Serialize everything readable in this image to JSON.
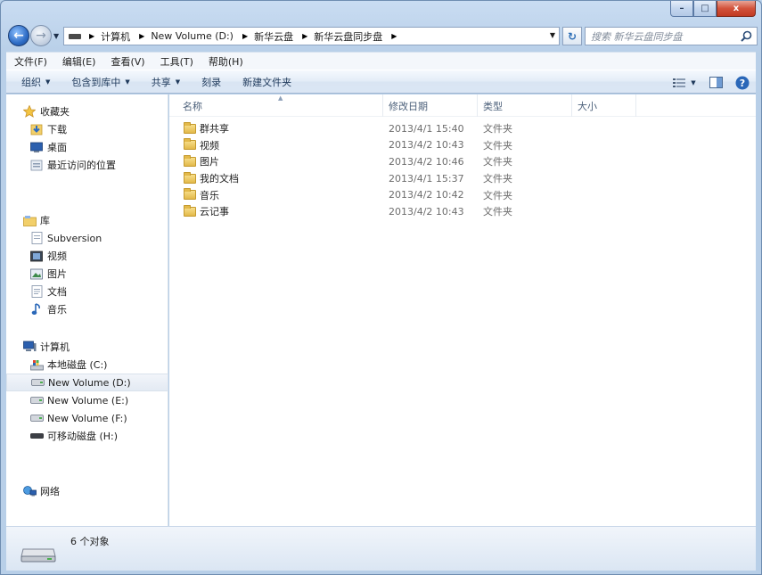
{
  "window": {
    "caption": {
      "minimize": "–",
      "maximize": "□",
      "close": "x"
    }
  },
  "address": {
    "crumbs": [
      "计算机",
      "New Volume (D:)",
      "新华云盘",
      "新华云盘同步盘"
    ]
  },
  "search": {
    "placeholder": "搜索 新华云盘同步盘"
  },
  "menu": [
    "文件(F)",
    "编辑(E)",
    "查看(V)",
    "工具(T)",
    "帮助(H)"
  ],
  "commands": {
    "organize": "组织",
    "include_library": "包含到库中",
    "share": "共享",
    "burn": "刻录",
    "new_folder": "新建文件夹"
  },
  "nav": {
    "favorites": {
      "label": "收藏夹",
      "items": [
        "下载",
        "桌面",
        "最近访问的位置"
      ]
    },
    "libraries": {
      "label": "库",
      "items": [
        "Subversion",
        "视频",
        "图片",
        "文档",
        "音乐"
      ]
    },
    "computer": {
      "label": "计算机",
      "items": [
        "本地磁盘 (C:)",
        "New Volume (D:)",
        "New Volume (E:)",
        "New Volume (F:)",
        "可移动磁盘 (H:)"
      ]
    },
    "network": {
      "label": "网络"
    }
  },
  "columns": {
    "name": "名称",
    "modified": "修改日期",
    "type": "类型",
    "size": "大小"
  },
  "files": [
    {
      "name": "群共享",
      "modified": "2013/4/1 15:40",
      "type": "文件夹"
    },
    {
      "name": "视频",
      "modified": "2013/4/2 10:43",
      "type": "文件夹"
    },
    {
      "name": "图片",
      "modified": "2013/4/2 10:46",
      "type": "文件夹"
    },
    {
      "name": "我的文档",
      "modified": "2013/4/1 15:37",
      "type": "文件夹"
    },
    {
      "name": "音乐",
      "modified": "2013/4/2 10:42",
      "type": "文件夹"
    },
    {
      "name": "云记事",
      "modified": "2013/4/2 10:43",
      "type": "文件夹"
    }
  ],
  "status": {
    "count": "6 个对象"
  }
}
